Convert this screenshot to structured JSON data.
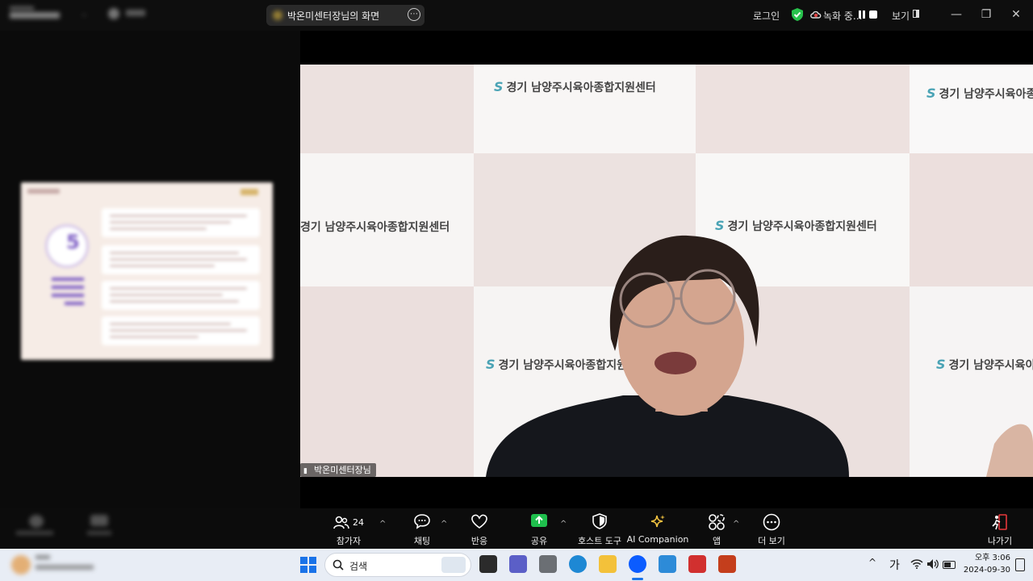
{
  "top_bar": {
    "share_title": "박온미센터장님의 화면",
    "login": "로그인",
    "recording": "녹화 중...",
    "view": "보기",
    "window": {
      "minimize": "—",
      "restore": "❐",
      "close": "✕"
    }
  },
  "video": {
    "banner_text": "경기 남양주시육아종합지원센터",
    "speaker_name": "박온미센터장님"
  },
  "toolbar": {
    "participants_label": "참가자",
    "participants_count": "24",
    "chat_label": "채팅",
    "reactions_label": "반응",
    "share_label": "공유",
    "host_tools_label": "호스트 도구",
    "ai_companion_label": "AI Companion",
    "apps_label": "앱",
    "more_label": "더 보기",
    "leave_label": "나가기"
  },
  "taskbar": {
    "search_placeholder": "검색",
    "ime": "가",
    "time": "오후 3:06",
    "date": "2024-09-30"
  },
  "colors": {
    "share_green": "#1fbf4d",
    "security_green": "#27c24c",
    "recording_red": "#e04545",
    "leave_red": "#e5383b"
  }
}
